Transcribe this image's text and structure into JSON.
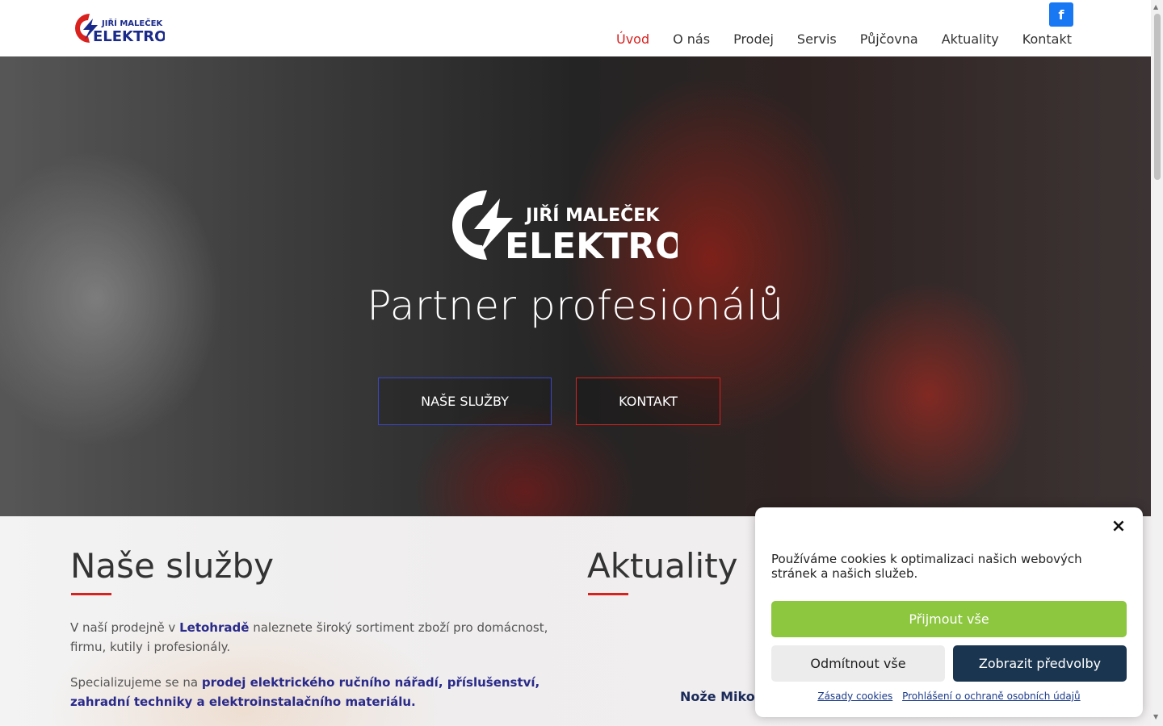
{
  "header": {
    "logo_top": "JIŘÍ MALEČEK",
    "logo_bottom": "ELEKTRO",
    "facebook_icon": "f",
    "nav": [
      "Úvod",
      "O nás",
      "Prodej",
      "Servis",
      "Půjčovna",
      "Aktuality",
      "Kontakt"
    ],
    "active_nav": "Úvod"
  },
  "hero": {
    "logo_top": "JIŘÍ MALEČEK",
    "logo_bottom": "ELEKTRO",
    "title": "Partner profesionálů",
    "button_services": "NAŠE SLUŽBY",
    "button_contact": "KONTAKT"
  },
  "services": {
    "title": "Naše služby",
    "p1_before": "V naší prodejně v ",
    "p1_link": "Letohradě",
    "p1_after": " naleznete široký sortiment zboží pro domácnost, firmu, kutily i profesionály.",
    "p2_before": "Specializujeme se na ",
    "p2_highlight": "prodej elektrického ručního nářadí, příslušenství, zahradní techniky a elektroinstalačního materiálu."
  },
  "news": {
    "title": "Aktuality",
    "item": "Nože Mikov"
  },
  "cookie": {
    "close": "×",
    "message": "Používáme cookies k optimalizaci našich webových stránek a našich služeb.",
    "accept": "Přijmout vše",
    "deny": "Odmítnout vše",
    "prefs": "Zobrazit předvolby",
    "link1": "Zásady cookies",
    "link2": "Prohlášení o ochraně osobních údajů"
  },
  "colors": {
    "brand_red": "#d9211e",
    "brand_blue": "#1a2a8a",
    "accept_green": "#8dc63f",
    "prefs_navy": "#1a3550",
    "facebook_blue": "#1877f2"
  }
}
